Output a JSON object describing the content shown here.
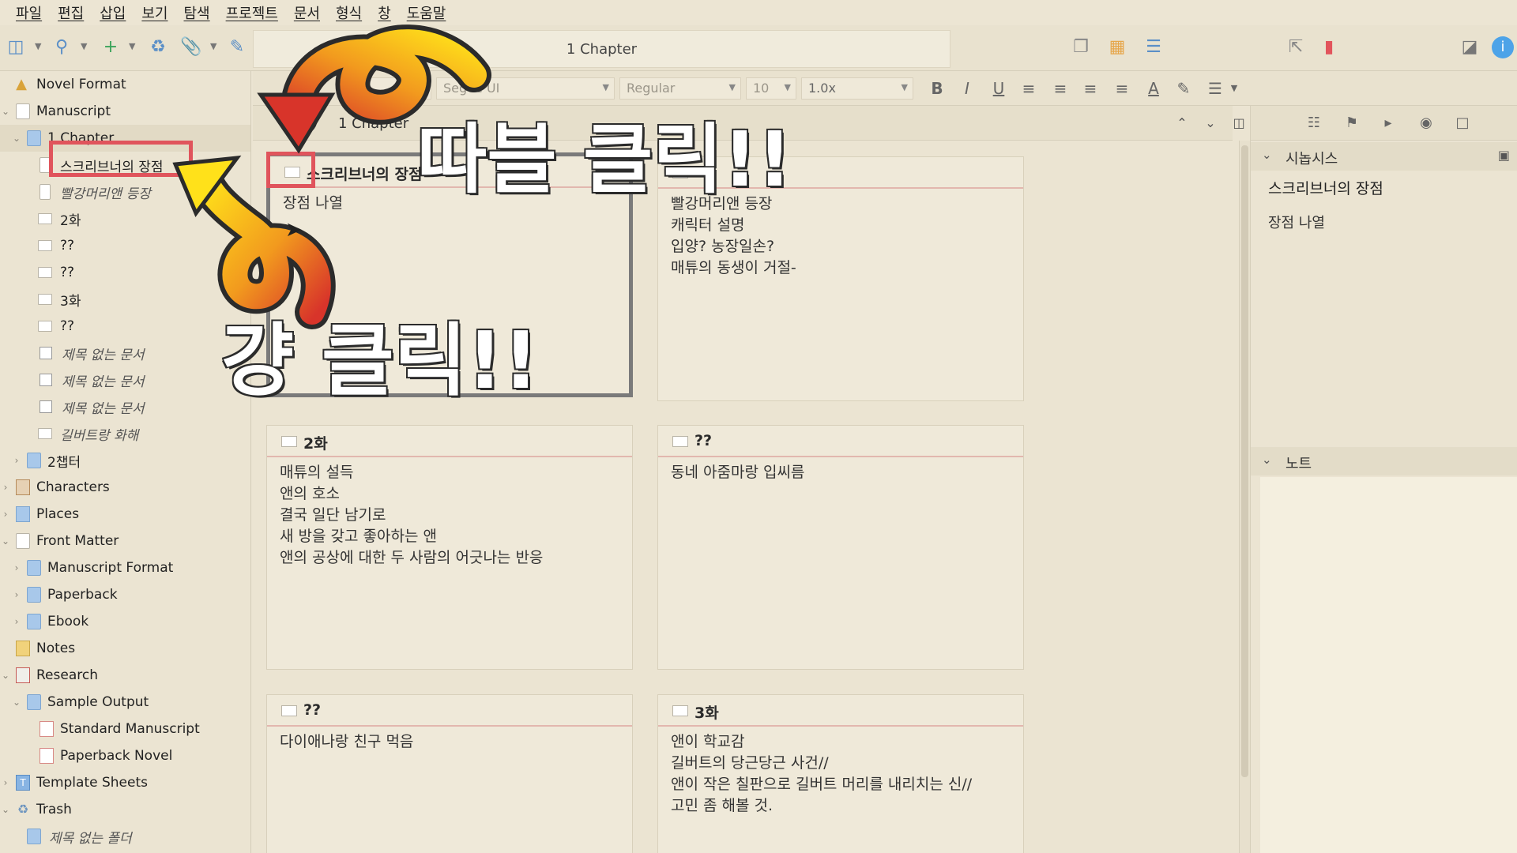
{
  "menu": [
    "파일",
    "편집",
    "삽입",
    "보기",
    "탐색",
    "프로젝트",
    "문서",
    "형식",
    "창",
    "도움말"
  ],
  "toolbar": {
    "title": "1 Chapter",
    "icons": [
      "binder-toggle-icon",
      "search-icon",
      "add-icon",
      "trash-icon",
      "attach-icon",
      "compose-icon",
      "view-single-icon",
      "view-corkboard-icon",
      "view-outline-icon",
      "share-icon",
      "bookmark-icon",
      "quick-reference-icon",
      "info-icon"
    ]
  },
  "format_bar": {
    "style_value": "",
    "font_value": "Segoe UI",
    "weight_value": "Regular",
    "size_value": "10",
    "spacing_value": "1.0x"
  },
  "header": {
    "title": "1 Chapter"
  },
  "binder": {
    "items": [
      {
        "label": "Novel Format",
        "icon": "warning-icon"
      },
      {
        "label": "Manuscript",
        "icon": "manuscript-icon"
      },
      {
        "label": "1 Chapter",
        "icon": "folder-icon"
      },
      {
        "label": "스크리브너의 장점",
        "icon": "document-icon"
      },
      {
        "label": "빨강머리앤 등장",
        "icon": "document-icon"
      },
      {
        "label": "2화",
        "icon": "card-icon"
      },
      {
        "label": "??",
        "icon": "card-icon"
      },
      {
        "label": "??",
        "icon": "card-icon"
      },
      {
        "label": "3화",
        "icon": "card-icon"
      },
      {
        "label": "??",
        "icon": "card-icon"
      },
      {
        "label": "제목 없는 문서",
        "icon": "checkbox-icon"
      },
      {
        "label": "제목 없는 문서",
        "icon": "checkbox-icon"
      },
      {
        "label": "제목 없는 문서",
        "icon": "checkbox-icon"
      },
      {
        "label": "길버트랑 화해",
        "icon": "card-icon"
      },
      {
        "label": "2챕터",
        "icon": "folder-icon"
      },
      {
        "label": "Characters",
        "icon": "characters-icon"
      },
      {
        "label": "Places",
        "icon": "places-icon"
      },
      {
        "label": "Front Matter",
        "icon": "front-matter-icon"
      },
      {
        "label": "Manuscript Format",
        "icon": "folder-icon"
      },
      {
        "label": "Paperback",
        "icon": "folder-icon"
      },
      {
        "label": "Ebook",
        "icon": "folder-icon"
      },
      {
        "label": "Notes",
        "icon": "notes-icon"
      },
      {
        "label": "Research",
        "icon": "research-icon"
      },
      {
        "label": "Sample Output",
        "icon": "folder-icon"
      },
      {
        "label": "Standard Manuscript",
        "icon": "sheet-icon"
      },
      {
        "label": "Paperback Novel",
        "icon": "sheet-icon"
      },
      {
        "label": "Template Sheets",
        "icon": "template-icon"
      },
      {
        "label": "Trash",
        "icon": "trash-icon"
      },
      {
        "label": "제목 없는 폴더",
        "icon": "folder-icon"
      }
    ]
  },
  "cards": [
    {
      "title": "스크리브너의 장점",
      "body": "장점 나열"
    },
    {
      "title": "",
      "body": "빨강머리앤 등장\n캐릭터 설명\n입양? 농장일손?\n매튜의 동생이 거절-"
    },
    {
      "title": "2화",
      "body": "매튜의 설득\n앤의 호소\n결국 일단 남기로\n새 방을 갖고 좋아하는 앤\n앤의 공상에 대한 두 사람의 어긋나는 반응"
    },
    {
      "title": "??",
      "body": "동네 아줌마랑 입씨름"
    },
    {
      "title": "??",
      "body": "다이애나랑 친구 먹음"
    },
    {
      "title": "3화",
      "body": "앤이 학교감\n길버트의 당근당근 사건//\n앤이 작은 칠판으로 길버트 머리를 내리치는 신//\n고민 좀 해볼 것."
    }
  ],
  "inspector": {
    "synopsis_label": "시놉시스",
    "synopsis_title": "스크리브너의 장점",
    "synopsis_text": "장점 나열",
    "notes_label": "노트"
  },
  "annotations": {
    "double_click": "따블 클릭!!",
    "single_click": "걍 클릭!!"
  },
  "colors": {
    "highlight_red": "#e0545c",
    "accent_blue": "#5b8fc7",
    "card_divider": "#e2b7ae",
    "arrow_orange": "#f29a1e",
    "arrow_red": "#d8342a",
    "arrow_yellow": "#ffe11a"
  }
}
